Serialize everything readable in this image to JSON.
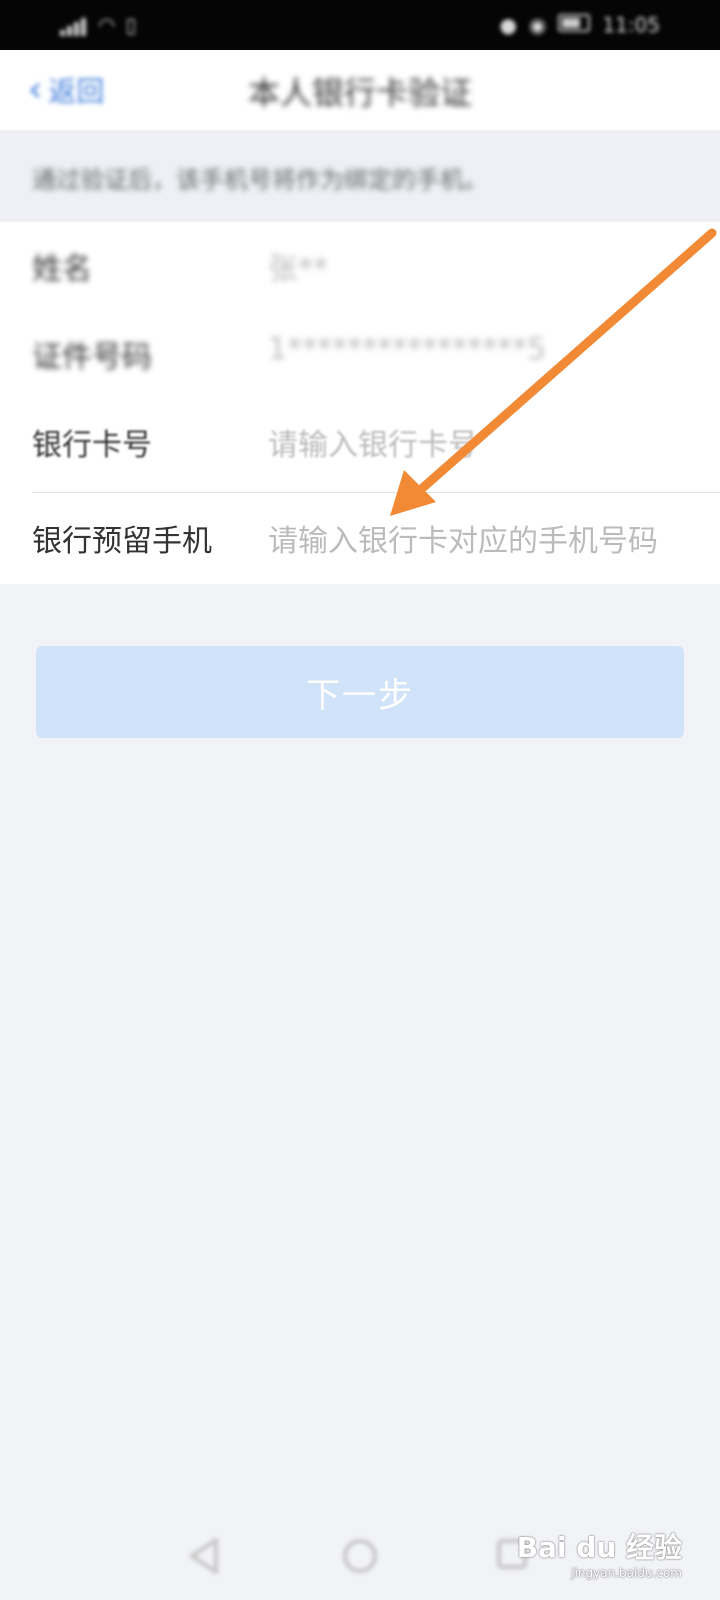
{
  "status_bar": {
    "left_icons": [
      "signal-icon",
      "wifi-icon",
      "sim-icon"
    ],
    "right_icons": [
      "alarm-icon",
      "vibrate-icon",
      "battery-icon"
    ],
    "time": "11:05"
  },
  "navbar": {
    "back_label": "返回",
    "title": "本人银行卡验证"
  },
  "notice": {
    "text": "通过验证后，该手机号将作为绑定的手机。"
  },
  "form": {
    "rows": [
      {
        "label": "姓名",
        "value": "张**"
      },
      {
        "label": "证件号码",
        "value": "1****************5"
      },
      {
        "label": "银行卡号",
        "placeholder": "请输入银行卡号"
      },
      {
        "label": "银行预留手机",
        "placeholder": "请输入银行卡对应的手机号码"
      }
    ]
  },
  "next_button": {
    "label": "下一步"
  },
  "annotation": {
    "arrow_color": "#f28a35"
  },
  "system_nav": {
    "icons": [
      "back-triangle-icon",
      "home-circle-icon",
      "recents-square-icon"
    ]
  },
  "watermark": {
    "brand": "Bai du 经验",
    "url": "jingyan.baidu.com"
  }
}
